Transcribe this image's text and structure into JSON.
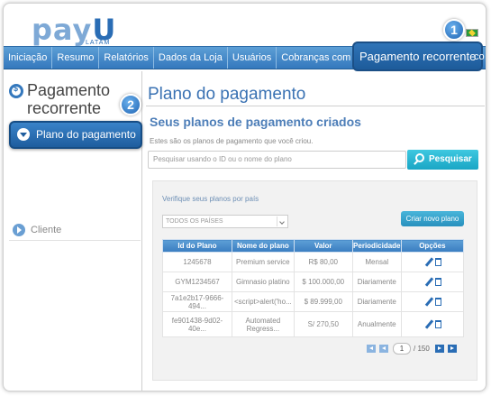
{
  "logo": {
    "brand_pre": "pay",
    "brand_u": "U",
    "sub": "LATAM"
  },
  "badges": {
    "one": "1",
    "two": "2"
  },
  "nav": {
    "items": [
      "Iniciação",
      "Resumo",
      "Relatórios",
      "Dados da Loja",
      "Usuários",
      "Cobranças com Token"
    ],
    "active": "Pagamento recorrente",
    "more": "co"
  },
  "sidebar": {
    "title": "Pagamento recorrente",
    "active_item": "Plano do pagamento",
    "item": "Cliente"
  },
  "main": {
    "title": "Plano do pagamento",
    "section_title": "Seus planos de pagamento criados",
    "description": "Estes são os planos de pagamento que você criou.",
    "search_placeholder": "Pesquisar usando o ID ou o nome do plano",
    "search_button": "Pesquisar",
    "filter_label": "Verifique seus planos por país",
    "filter_value": "TODOS OS PAÍSES",
    "new_plan_button": "Criar novo plano"
  },
  "table": {
    "headers": [
      "Id do Plano",
      "Nome do plano",
      "Valor",
      "Periodicidade",
      "Opções"
    ],
    "rows": [
      {
        "id": "1245678",
        "name": "Premium service",
        "value": "R$ 80,00",
        "period": "Mensal"
      },
      {
        "id": "GYM1234567",
        "name": "Gimnasio platino",
        "value": "$ 100.000,00",
        "period": "Diariamente"
      },
      {
        "id": "7a1e2b17-9666-494...",
        "name": "<script>alert('ho...",
        "value": "$ 89.999,00",
        "period": "Diariamente"
      },
      {
        "id": "fe901438-9d02-40e...",
        "name": "Automated Regress...",
        "value": "S/ 270,50",
        "period": "Anualmente"
      }
    ]
  },
  "pager": {
    "current": "1",
    "total": "/ 150"
  },
  "colors": {
    "accent": "#3478bd",
    "search_button": "#1aa6c5"
  }
}
